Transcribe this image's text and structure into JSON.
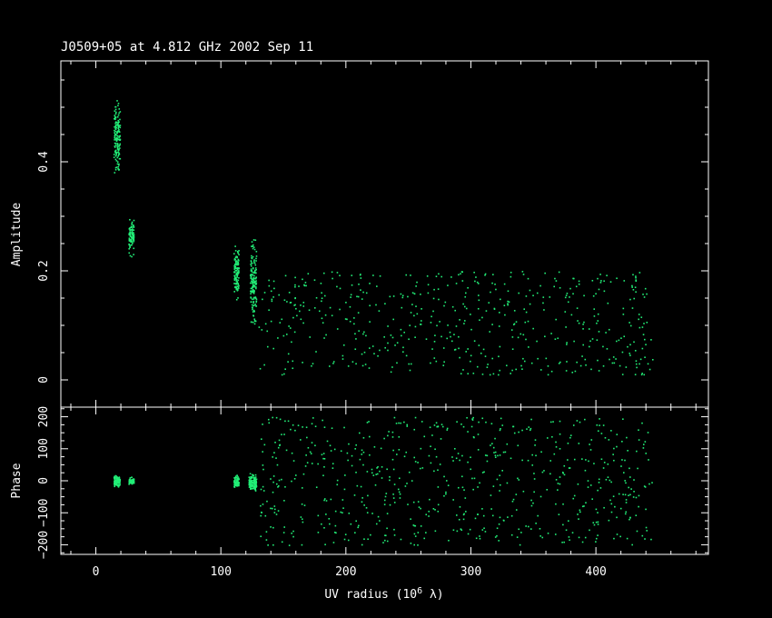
{
  "chart_data": {
    "type": "scatter",
    "title": "J0509+05 at 4.812 GHz 2002 Sep 11",
    "xlabel": "UV radius  (10",
    "xlabel_exp": "6",
    "xlabel_unit": " λ)",
    "xlim": [
      -28,
      490
    ],
    "x_ticks": [
      0,
      100,
      200,
      300,
      400
    ],
    "point_color": "#22ee77",
    "panels": [
      {
        "name": "amplitude",
        "ylabel": "Amplitude",
        "ylim": [
          -0.05,
          0.585
        ],
        "y_ticks": [
          0,
          0.2,
          0.4
        ],
        "y_tick_labels": [
          "0",
          "0.2",
          "0.4"
        ],
        "clusters": [
          {
            "x_min": 14,
            "x_max": 19,
            "y_min": 0.36,
            "y_max": 0.53,
            "n": 150
          },
          {
            "x_min": 26,
            "x_max": 30,
            "y_min": 0.22,
            "y_max": 0.31,
            "n": 90
          },
          {
            "x_min": 110,
            "x_max": 114,
            "y_min": 0.14,
            "y_max": 0.26,
            "n": 110
          },
          {
            "x_min": 123,
            "x_max": 128,
            "y_min": 0.08,
            "y_max": 0.28,
            "n": 150
          },
          {
            "x_min": 130,
            "x_max": 445,
            "y_min": 0.01,
            "y_max": 0.2,
            "n": 520
          }
        ]
      },
      {
        "name": "phase",
        "ylabel": "Phase",
        "ylim": [
          -230,
          230
        ],
        "y_ticks": [
          -200,
          -100,
          0,
          100,
          200
        ],
        "y_tick_labels": [
          "−200",
          "−100",
          "0",
          "100",
          "200"
        ],
        "clusters": [
          {
            "x_min": 14,
            "x_max": 19,
            "y_min": -25,
            "y_max": 25,
            "n": 90
          },
          {
            "x_min": 26,
            "x_max": 30,
            "y_min": -15,
            "y_max": 15,
            "n": 70
          },
          {
            "x_min": 110,
            "x_max": 114,
            "y_min": -25,
            "y_max": 25,
            "n": 80
          },
          {
            "x_min": 122,
            "x_max": 128,
            "y_min": -40,
            "y_max": 35,
            "n": 130
          },
          {
            "x_min": 130,
            "x_max": 445,
            "y_min": -200,
            "y_max": 200,
            "n": 650
          }
        ]
      }
    ]
  }
}
